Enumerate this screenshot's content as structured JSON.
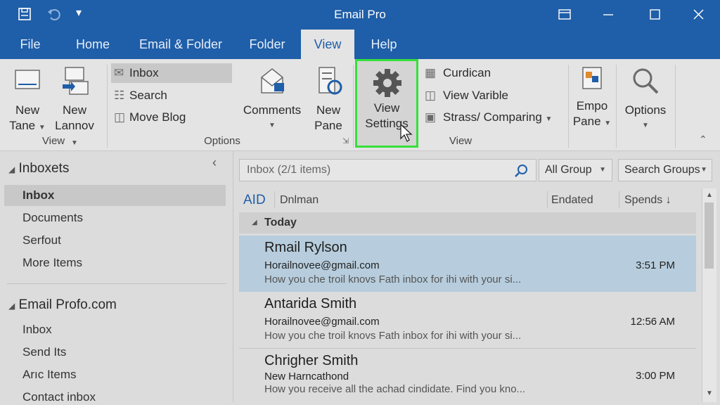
{
  "app": {
    "title": "Email Pro"
  },
  "tabs": [
    "File",
    "Home",
    "Email & Folder",
    "Folder",
    "View",
    "Help"
  ],
  "ribbon": {
    "new_tane": [
      "New",
      "Tane"
    ],
    "new_lannov": [
      "New",
      "Lannov"
    ],
    "group_view_left": "View",
    "options_items": [
      "Inbox",
      "Search",
      "Move Blog"
    ],
    "comments": "Comments",
    "new_pane": [
      "New",
      "Pane"
    ],
    "group_options": "Options",
    "view_settings": [
      "View",
      "Settings"
    ],
    "right_items": [
      "Curdican",
      "View Varible",
      "Strass/ Comparing"
    ],
    "group_view_right": "View",
    "empo_pane": [
      "Empo",
      "Pane"
    ],
    "options": "Options"
  },
  "folders": {
    "account1": "Inboxets",
    "account1_items": [
      "Inbox",
      "Documents",
      "Serfout",
      "More Items"
    ],
    "account2": "Email Profo.com",
    "account2_items": [
      "Inbox",
      "Send Its",
      "Arıc Items",
      "Contact inbox"
    ]
  },
  "search": {
    "placeholder": "Inbox (2/1 items)",
    "group": "All Group",
    "search_groups": "Search Groups"
  },
  "columns": {
    "aid": "AID",
    "dnlman": "Dnlman",
    "endated": "Endated",
    "spends": "Spends ↓"
  },
  "list": {
    "group": "Today",
    "messages": [
      {
        "name": "Rmail Rylson",
        "email": "Horailnovee@gmail.com",
        "preview": "How you che troil knovs Fath inbox for ihi with your si...",
        "time": "3:51 PM"
      },
      {
        "name": "Antarida Smith",
        "email": "Horailnovee@gmail.com",
        "preview": "How you che troil knovs Fath inbox for ihi with your si...",
        "time": "12:56 AM"
      },
      {
        "name": "Chrigher Smith",
        "email": "New Harncathond",
        "preview": "How you receive all the achad cindidate. Find you kno...",
        "time": "3:00 PM"
      }
    ]
  },
  "colors": {
    "titlebar": "#1f5ea8",
    "ribbon": "#e4e4e4",
    "highlight": "#36e03a",
    "selected_row": "#b7cddd"
  }
}
